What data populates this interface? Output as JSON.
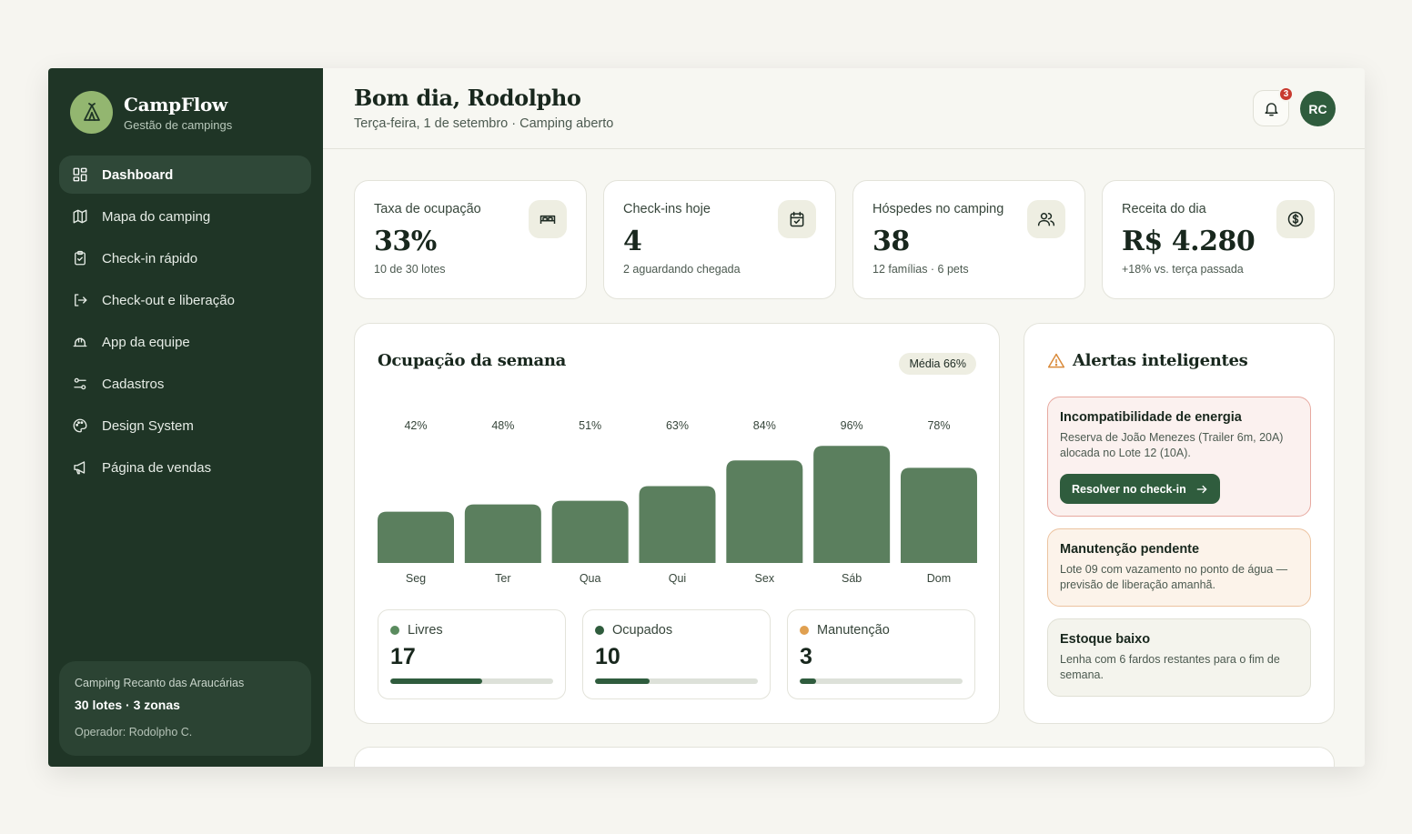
{
  "brand": {
    "name": "CampFlow",
    "subtitle": "Gestão de campings"
  },
  "nav": [
    {
      "label": "Dashboard",
      "icon": "grid-icon",
      "active": true
    },
    {
      "label": "Mapa do camping",
      "icon": "map-icon"
    },
    {
      "label": "Check-in rápido",
      "icon": "clipboard-check-icon"
    },
    {
      "label": "Check-out e liberação",
      "icon": "logout-icon"
    },
    {
      "label": "App da equipe",
      "icon": "hard-hat-icon"
    },
    {
      "label": "Cadastros",
      "icon": "sliders-icon"
    },
    {
      "label": "Design System",
      "icon": "palette-icon"
    },
    {
      "label": "Página de vendas",
      "icon": "megaphone-icon"
    }
  ],
  "site": {
    "name": "Camping Recanto das Araucárias",
    "lots": "30 lotes · 3 zonas",
    "operator": "Operador: Rodolpho C."
  },
  "header": {
    "greeting": "Bom dia, Rodolpho",
    "date": "Terça-feira, 1 de setembro · Camping aberto",
    "notifications": "3",
    "avatar": "RC"
  },
  "stats": [
    {
      "label": "Taxa de ocupação",
      "value": "33%",
      "sub": "10 de 30 lotes",
      "icon": "bed-icon"
    },
    {
      "label": "Check-ins hoje",
      "value": "4",
      "sub": "2 aguardando chegada",
      "icon": "calendar-check-icon"
    },
    {
      "label": "Hóspedes no camping",
      "value": "38",
      "sub": "12 famílias · 6 pets",
      "icon": "users-icon"
    },
    {
      "label": "Receita do dia",
      "value": "R$ 4.280",
      "sub": "+18% vs. terça passada",
      "icon": "dollar-circle-icon"
    }
  ],
  "chart": {
    "title": "Ocupação da semana",
    "average": "Média 66%"
  },
  "chart_data": {
    "type": "bar",
    "categories": [
      "Seg",
      "Ter",
      "Qua",
      "Qui",
      "Sex",
      "Sáb",
      "Dom"
    ],
    "values": [
      42,
      48,
      51,
      63,
      84,
      96,
      78
    ],
    "value_labels": [
      "42%",
      "48%",
      "51%",
      "63%",
      "84%",
      "96%",
      "78%"
    ],
    "color": "#5b7f5e"
  },
  "legend": [
    {
      "label": "Livres",
      "value": "17",
      "fraction": 0.567,
      "dot": "#5a8b5e"
    },
    {
      "label": "Ocupados",
      "value": "10",
      "fraction": 0.333,
      "dot": "#2f5c3d"
    },
    {
      "label": "Manutenção",
      "value": "3",
      "fraction": 0.1,
      "dot": "#e0a050"
    }
  ],
  "alerts": {
    "title": "Alertas inteligentes",
    "items": [
      {
        "title": "Incompatibilidade de energia",
        "text": "Reserva de João Menezes (Trailer 6m, 20A) alocada no Lote 12 (10A).",
        "action": "Resolver no check-in"
      },
      {
        "title": "Manutenção pendente",
        "text": "Lote 09 com vazamento no ponto de água — previsão de liberação amanhã."
      },
      {
        "title": "Estoque baixo",
        "text": "Lenha com 6 fardos restantes para o fim de semana."
      }
    ]
  },
  "colors": {
    "sidebar": "#1f3526",
    "accent": "#2f5c3d",
    "bar": "#5b7f5e",
    "danger": "#c83a2f",
    "warning": "#d98a3a"
  }
}
